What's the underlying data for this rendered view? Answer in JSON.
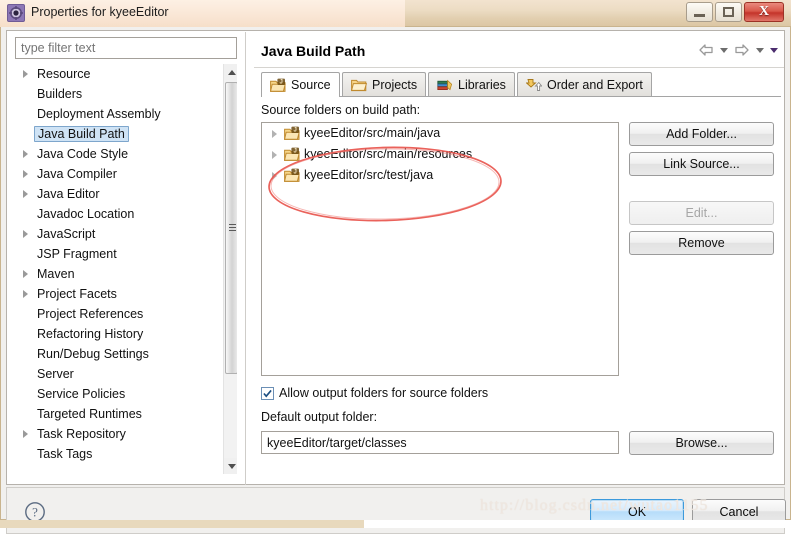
{
  "window": {
    "title": "Properties for kyeeEditor",
    "icon": "properties-gear-icon",
    "buttons": {
      "minimize": "minimize-icon",
      "maximize": "maximize-icon",
      "close": "X"
    }
  },
  "filter": {
    "placeholder": "type filter text",
    "value": ""
  },
  "tree": {
    "items": [
      {
        "label": "Resource",
        "expandable": true,
        "selected": false
      },
      {
        "label": "Builders",
        "expandable": false,
        "selected": false
      },
      {
        "label": "Deployment Assembly",
        "expandable": false,
        "selected": false
      },
      {
        "label": "Java Build Path",
        "expandable": false,
        "selected": true
      },
      {
        "label": "Java Code Style",
        "expandable": true,
        "selected": false
      },
      {
        "label": "Java Compiler",
        "expandable": true,
        "selected": false
      },
      {
        "label": "Java Editor",
        "expandable": true,
        "selected": false
      },
      {
        "label": "Javadoc Location",
        "expandable": false,
        "selected": false
      },
      {
        "label": "JavaScript",
        "expandable": true,
        "selected": false
      },
      {
        "label": "JSP Fragment",
        "expandable": false,
        "selected": false
      },
      {
        "label": "Maven",
        "expandable": true,
        "selected": false
      },
      {
        "label": "Project Facets",
        "expandable": true,
        "selected": false
      },
      {
        "label": "Project References",
        "expandable": false,
        "selected": false
      },
      {
        "label": "Refactoring History",
        "expandable": false,
        "selected": false
      },
      {
        "label": "Run/Debug Settings",
        "expandable": false,
        "selected": false
      },
      {
        "label": "Server",
        "expandable": false,
        "selected": false
      },
      {
        "label": "Service Policies",
        "expandable": false,
        "selected": false
      },
      {
        "label": "Targeted Runtimes",
        "expandable": false,
        "selected": false
      },
      {
        "label": "Task Repository",
        "expandable": true,
        "selected": false
      },
      {
        "label": "Task Tags",
        "expandable": false,
        "selected": false
      }
    ]
  },
  "page": {
    "title": "Java Build Path",
    "nav": {
      "back": "back-arrow-icon",
      "back_menu": "chevron-down-icon",
      "forward": "forward-arrow-icon",
      "forward_menu": "chevron-down-icon",
      "view_menu": "chevron-down-icon"
    }
  },
  "tabs": [
    {
      "label": "Source",
      "icon": "source-folder-icon",
      "active": true
    },
    {
      "label": "Projects",
      "icon": "open-folder-icon",
      "active": false
    },
    {
      "label": "Libraries",
      "icon": "books-jar-icon",
      "active": false
    },
    {
      "label": "Order and Export",
      "icon": "order-export-arrows-icon",
      "active": false
    }
  ],
  "source_tab": {
    "list_label": "Source folders on build path:",
    "entries": [
      {
        "label": "kyeeEditor/src/main/java",
        "icon": "source-folder-icon"
      },
      {
        "label": "kyeeEditor/src/main/resources",
        "icon": "source-folder-icon"
      },
      {
        "label": "kyeeEditor/src/test/java",
        "icon": "source-folder-icon"
      }
    ],
    "buttons": [
      {
        "label": "Add Folder...",
        "enabled": true
      },
      {
        "label": "Link Source...",
        "enabled": true
      },
      {
        "label": "Edit...",
        "enabled": false
      },
      {
        "label": "Remove",
        "enabled": true
      }
    ],
    "allow_output": {
      "label": "Allow output folders for source folders",
      "checked": true
    },
    "default_output": {
      "label": "Default output folder:",
      "value": "kyeeEditor/target/classes",
      "browse_label": "Browse..."
    }
  },
  "annotation": {
    "type": "ellipse-highlight",
    "color": "#e8554d"
  },
  "footer": {
    "help": "help-icon",
    "ok_label": "OK",
    "cancel_label": "Cancel"
  },
  "watermark": "http://blog.csdn.net/wutao1155",
  "colors": {
    "titlebar": "#ecdcc3",
    "selection": "#cfe3f5",
    "accent": "#3c9adc",
    "annotation": "#e8554d",
    "folder": "#f3c05a"
  }
}
